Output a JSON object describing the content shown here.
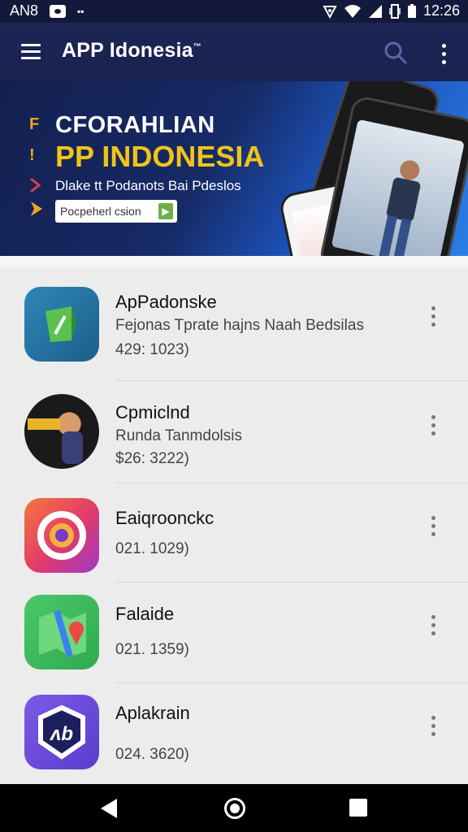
{
  "status_bar": {
    "carrier": "AN8",
    "time": "12:26",
    "icons": [
      "notification-box-icon",
      "cast-icon",
      "nfc-icon",
      "wifi-icon",
      "signal-icon",
      "vibrate-icon",
      "battery-icon"
    ]
  },
  "toolbar": {
    "title": "APP Idonesia",
    "title_mark": "™",
    "icons": [
      "menu-icon",
      "search-icon",
      "more-vert-icon"
    ]
  },
  "banner": {
    "line1": "CFORAHLIAN",
    "line2": "PP INDONESIA",
    "line3": "Dlake tt Podanots Bai Pdeslos",
    "cta": "Pocpeherl csion",
    "mark1": "F",
    "mark2": "!",
    "colors": {
      "title": "#ffffff",
      "highlight": "#f2c417",
      "accent": "#f0a51a"
    }
  },
  "apps": [
    {
      "name": "ApPadonske",
      "subtitle": "Fejonas Tprate hajns Naah Bedsilas",
      "number": "429: 1023)",
      "icon": "green-shield-app-icon"
    },
    {
      "name": "Cpmiclnd",
      "subtitle": "Runda Tanmdolsis",
      "number": "$26: 3222)",
      "icon": "man-portrait-app-icon"
    },
    {
      "name": "Eaiqroonckc",
      "subtitle": "",
      "number": "021. 1029)",
      "icon": "camera-gradient-app-icon"
    },
    {
      "name": "Falaide",
      "subtitle": "",
      "number": "021. 1359)",
      "icon": "maps-app-icon"
    },
    {
      "name": "Aplakrain",
      "subtitle": "",
      "number": "024. 3620)",
      "icon": "purple-badge-app-icon"
    }
  ],
  "nav": {
    "icons": [
      "back-icon",
      "home-icon",
      "recents-icon"
    ]
  }
}
